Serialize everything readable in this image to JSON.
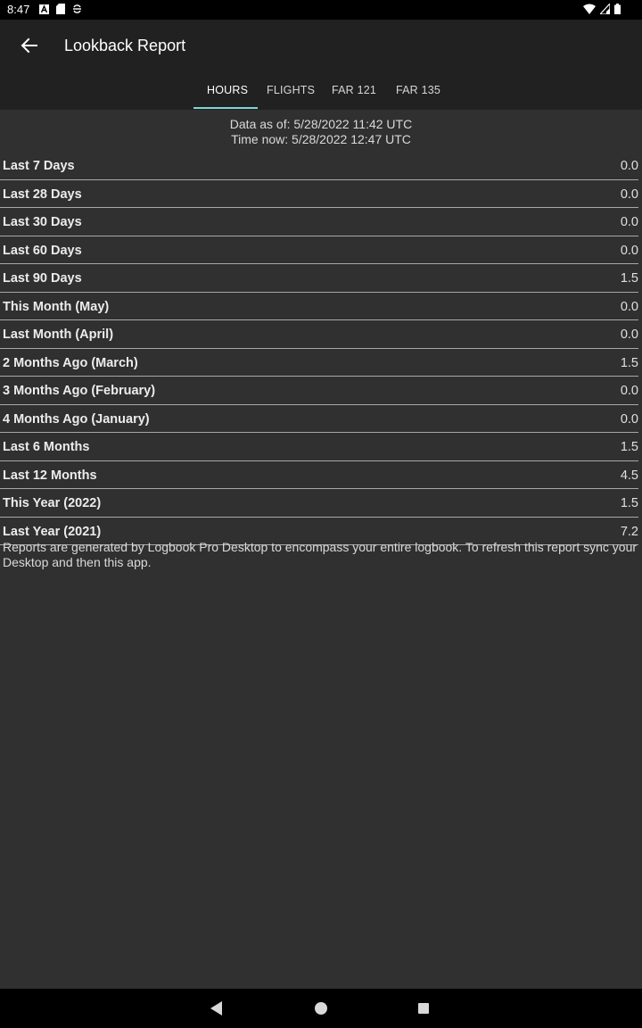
{
  "status_bar": {
    "time": "8:47",
    "icons": [
      "a-box-icon",
      "sd-card-icon",
      "sync-icon"
    ],
    "right_icons": [
      "wifi-icon",
      "signal-icon",
      "battery-icon"
    ]
  },
  "appbar": {
    "title": "Lookback Report",
    "back_icon": "arrow-left-icon"
  },
  "tabs": [
    {
      "label": "HOURS",
      "active": true
    },
    {
      "label": "FLIGHTS",
      "active": false
    },
    {
      "label": "FAR 121",
      "active": false
    },
    {
      "label": "FAR 135",
      "active": false
    }
  ],
  "meta": {
    "data_as_of": "Data as of: 5/28/2022 11:42 UTC",
    "time_now": "Time now: 5/28/2022 12:47 UTC"
  },
  "rows": [
    {
      "label": "Last 7 Days",
      "value": "0.0"
    },
    {
      "label": "Last 28 Days",
      "value": "0.0"
    },
    {
      "label": "Last 30 Days",
      "value": "0.0"
    },
    {
      "label": "Last 60 Days",
      "value": "0.0"
    },
    {
      "label": "Last 90 Days",
      "value": "1.5"
    },
    {
      "label": "This Month (May)",
      "value": "0.0"
    },
    {
      "label": "Last Month (April)",
      "value": "0.0"
    },
    {
      "label": "2 Months Ago (March)",
      "value": "1.5"
    },
    {
      "label": "3 Months Ago (February)",
      "value": "0.0"
    },
    {
      "label": "4 Months Ago (January)",
      "value": "0.0"
    },
    {
      "label": "Last 6 Months",
      "value": "1.5"
    },
    {
      "label": "Last 12 Months",
      "value": "4.5"
    },
    {
      "label": "This Year (2022)",
      "value": "1.5"
    },
    {
      "label": "Last Year (2021)",
      "value": "7.2"
    }
  ],
  "note": "Reports are generated by Logbook Pro Desktop to encompass your entire logbook. To refresh this report sync your Desktop and then this app.",
  "colors": {
    "background": "#303030",
    "appbar": "#212121",
    "accent": "#7fd7cf"
  }
}
